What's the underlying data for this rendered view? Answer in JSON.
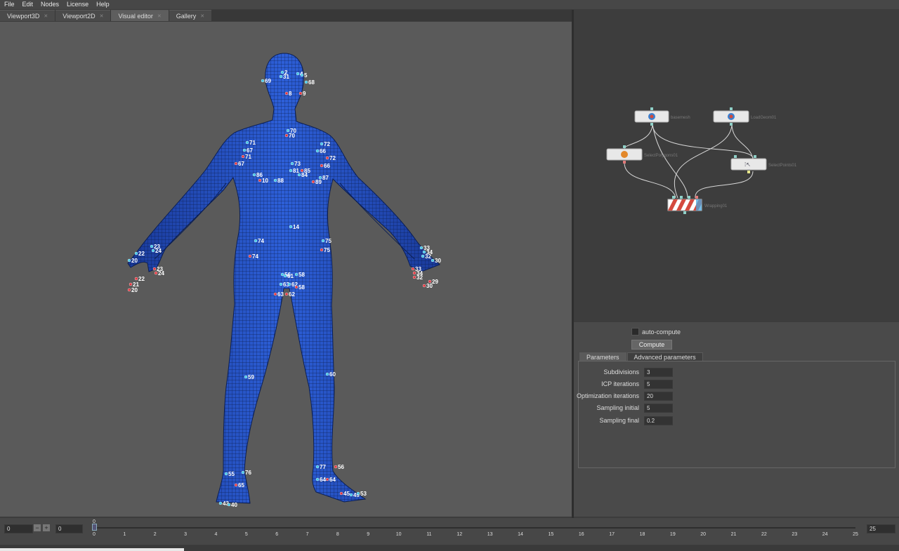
{
  "menu": [
    "File",
    "Edit",
    "Nodes",
    "License",
    "Help"
  ],
  "tabs": [
    {
      "label": "Viewport3D",
      "active": false
    },
    {
      "label": "Viewport2D",
      "active": false
    },
    {
      "label": "Visual editor",
      "active": true
    },
    {
      "label": "Gallery",
      "active": false
    }
  ],
  "nodes": {
    "basemesh": "basemesh",
    "loadgeom": "LoadGeom01",
    "selectpolygons": "SelectPolygons01",
    "selectpoints": "SelectPoints01",
    "wrapping": "Wrapping01"
  },
  "panel": {
    "auto_compute_label": "auto-compute",
    "auto_compute_checked": false,
    "compute_label": "Compute",
    "tabs": [
      "Parameters",
      "Advanced parameters"
    ],
    "params": [
      {
        "label": "Subdivisions",
        "value": "3"
      },
      {
        "label": "ICP iterations",
        "value": "5"
      },
      {
        "label": "Optimization iterations",
        "value": "20"
      },
      {
        "label": "Sampling initial",
        "value": "5"
      },
      {
        "label": "Sampling final",
        "value": "0.2"
      }
    ]
  },
  "timeline": {
    "start": "0",
    "current": "0",
    "end": "25",
    "playhead_frame": "0",
    "ticks": [
      "0",
      "1",
      "2",
      "3",
      "4",
      "5",
      "6",
      "7",
      "8",
      "9",
      "10",
      "11",
      "12",
      "13",
      "14",
      "15",
      "16",
      "17",
      "18",
      "19",
      "20",
      "21",
      "22",
      "23",
      "24",
      "25"
    ],
    "minus": "−",
    "plus": "+"
  },
  "markers": [
    {
      "t": "69",
      "c": "c"
    },
    {
      "t": "68",
      "c": "c"
    },
    {
      "t": "2",
      "c": "c"
    },
    {
      "t": "31",
      "c": "c"
    },
    {
      "t": "4",
      "c": "c"
    },
    {
      "t": "5",
      "c": "c"
    },
    {
      "t": "8",
      "c": "r"
    },
    {
      "t": "9",
      "c": "r"
    },
    {
      "t": "70",
      "c": "c"
    },
    {
      "t": "70",
      "c": "r"
    },
    {
      "t": "71",
      "c": "c"
    },
    {
      "t": "67",
      "c": "c"
    },
    {
      "t": "71",
      "c": "r"
    },
    {
      "t": "67",
      "c": "r"
    },
    {
      "t": "72",
      "c": "c"
    },
    {
      "t": "66",
      "c": "c"
    },
    {
      "t": "72",
      "c": "r"
    },
    {
      "t": "66",
      "c": "r"
    },
    {
      "t": "73",
      "c": "c"
    },
    {
      "t": "81",
      "c": "c"
    },
    {
      "t": "85",
      "c": "r"
    },
    {
      "t": "86",
      "c": "c"
    },
    {
      "t": "10",
      "c": "r"
    },
    {
      "t": "88",
      "c": "c"
    },
    {
      "t": "84",
      "c": "c"
    },
    {
      "t": "87",
      "c": "c"
    },
    {
      "t": "89",
      "c": "r"
    },
    {
      "t": "14",
      "c": "c"
    },
    {
      "t": "74",
      "c": "c"
    },
    {
      "t": "74",
      "c": "r"
    },
    {
      "t": "75",
      "c": "c"
    },
    {
      "t": "75",
      "c": "r"
    },
    {
      "t": "23",
      "c": "c"
    },
    {
      "t": "24",
      "c": "c"
    },
    {
      "t": "22",
      "c": "c"
    },
    {
      "t": "20",
      "c": "c"
    },
    {
      "t": "23",
      "c": "r"
    },
    {
      "t": "24",
      "c": "r"
    },
    {
      "t": "22",
      "c": "r"
    },
    {
      "t": "21",
      "c": "r"
    },
    {
      "t": "20",
      "c": "r"
    },
    {
      "t": "33",
      "c": "c"
    },
    {
      "t": "34",
      "c": "c"
    },
    {
      "t": "32",
      "c": "c"
    },
    {
      "t": "30",
      "c": "c"
    },
    {
      "t": "33",
      "c": "r"
    },
    {
      "t": "34",
      "c": "r"
    },
    {
      "t": "32",
      "c": "r"
    },
    {
      "t": "29",
      "c": "r"
    },
    {
      "t": "30",
      "c": "r"
    },
    {
      "t": "56",
      "c": "c"
    },
    {
      "t": "61",
      "c": "c"
    },
    {
      "t": "58",
      "c": "c"
    },
    {
      "t": "63",
      "c": "c"
    },
    {
      "t": "62",
      "c": "c"
    },
    {
      "t": "58",
      "c": "r"
    },
    {
      "t": "63",
      "c": "r"
    },
    {
      "t": "62",
      "c": "r"
    },
    {
      "t": "59",
      "c": "c"
    },
    {
      "t": "60",
      "c": "c"
    },
    {
      "t": "55",
      "c": "c"
    },
    {
      "t": "76",
      "c": "c"
    },
    {
      "t": "65",
      "c": "r"
    },
    {
      "t": "77",
      "c": "c"
    },
    {
      "t": "56",
      "c": "r"
    },
    {
      "t": "64",
      "c": "c"
    },
    {
      "t": "64",
      "c": "r"
    },
    {
      "t": "43",
      "c": "c"
    },
    {
      "t": "40",
      "c": "c"
    },
    {
      "t": "45",
      "c": "r"
    },
    {
      "t": "49",
      "c": "c"
    },
    {
      "t": "53",
      "c": "c"
    }
  ]
}
